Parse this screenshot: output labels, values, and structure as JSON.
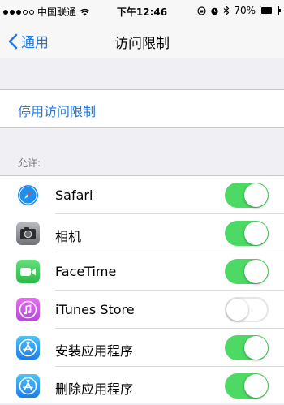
{
  "status_bar": {
    "carrier": "中国联通",
    "time": "下午12:46",
    "battery": "70%",
    "battery_level": 0.7
  },
  "nav": {
    "back_label": "通用",
    "title": "访问限制"
  },
  "disable_label": "停用访问限制",
  "allow_header": "允许:",
  "apps": [
    {
      "label": "Safari",
      "icon": "safari-icon",
      "enabled": true
    },
    {
      "label": "相机",
      "icon": "camera-icon",
      "enabled": true
    },
    {
      "label": "FaceTime",
      "icon": "facetime-icon",
      "enabled": true
    },
    {
      "label": "iTunes Store",
      "icon": "itunes-icon",
      "enabled": false
    },
    {
      "label": "安装应用程序",
      "icon": "app-store-icon",
      "enabled": true
    },
    {
      "label": "删除应用程序",
      "icon": "app-store-icon",
      "enabled": true
    }
  ],
  "colors": {
    "accent": "#1f7ae0",
    "toggle_on": "#4cd964"
  }
}
